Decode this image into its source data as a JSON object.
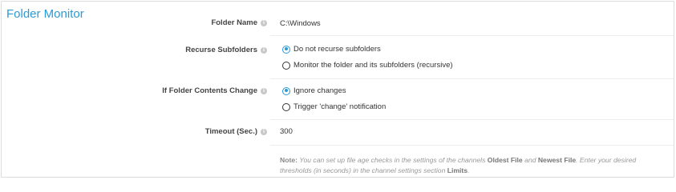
{
  "section": {
    "title": "Folder Monitor"
  },
  "fields": {
    "folder_name": {
      "label": "Folder Name",
      "value": "C:\\Windows"
    },
    "recurse": {
      "label": "Recurse Subfolders",
      "options": [
        {
          "label": "Do not recurse subfolders",
          "checked": true
        },
        {
          "label": "Monitor the folder and its subfolders (recursive)",
          "checked": false
        }
      ]
    },
    "contents_change": {
      "label": "If Folder Contents Change",
      "options": [
        {
          "label": "Ignore changes",
          "checked": true
        },
        {
          "label": "Trigger 'change' notification",
          "checked": false
        }
      ]
    },
    "timeout": {
      "label": "Timeout (Sec.)",
      "value": "300"
    }
  },
  "note": {
    "prefix": "Note:",
    "text1": " You can set up file age checks in the settings of the channels ",
    "oldest": "Oldest File",
    "and": " and ",
    "newest": "Newest File",
    "text2": ". Enter your desired thresholds (in seconds) in the channel settings section ",
    "limits": "Limits",
    "end": "."
  },
  "colors": {
    "accent": "#2b9ad6",
    "label": "#444444",
    "note": "#999999"
  },
  "icons": {
    "info": "info-icon"
  }
}
